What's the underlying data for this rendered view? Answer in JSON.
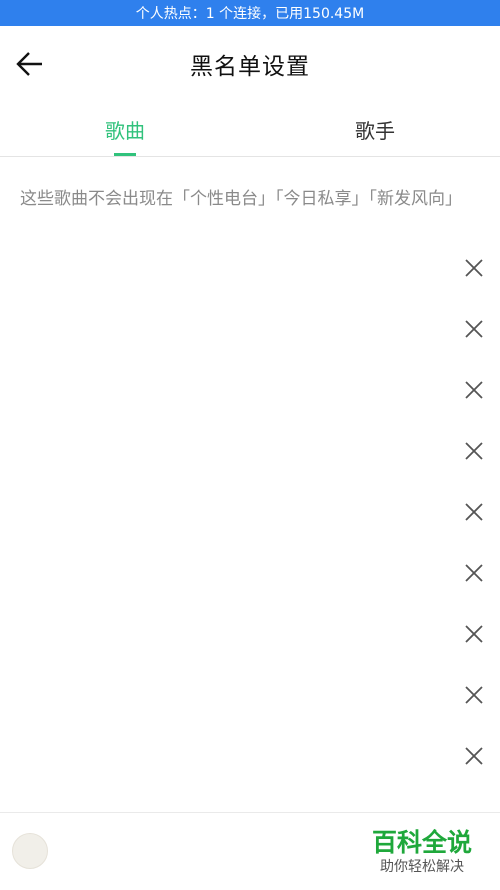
{
  "hotspot": {
    "text": "个人热点：1 个连接，已用150.45M"
  },
  "header": {
    "title": "黑名单设置",
    "back_icon": "arrow-left-icon"
  },
  "tabs": [
    {
      "label": "歌曲",
      "active": true
    },
    {
      "label": "歌手",
      "active": false
    }
  ],
  "notice": "这些歌曲不会出现在「个性电台」「今日私享」「新发风向」",
  "songs": [
    {},
    {},
    {},
    {},
    {},
    {},
    {},
    {},
    {}
  ],
  "remove_icon": "close-icon",
  "watermark": {
    "main": "百科全说",
    "sub": "助你轻松解决"
  },
  "colors": {
    "accent": "#31c27c",
    "status_bar": "#2f80ed",
    "watermark": "#1fa83b"
  }
}
